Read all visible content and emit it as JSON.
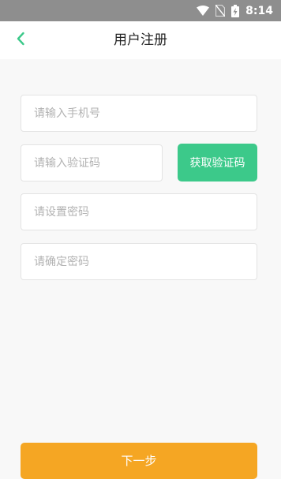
{
  "status_bar": {
    "time": "8:14",
    "icons": [
      "wifi-icon",
      "no-sim-icon",
      "battery-icon"
    ]
  },
  "header": {
    "back_icon": "chevron-left-icon",
    "title": "用户注册"
  },
  "form": {
    "phone_placeholder": "请输入手机号",
    "code_placeholder": "请输入验证码",
    "get_code_label": "获取验证码",
    "password_placeholder": "请设置密码",
    "confirm_placeholder": "请确定密码"
  },
  "footer": {
    "next_label": "下一步"
  },
  "colors": {
    "accent_green": "#3cc98a",
    "next_orange": "#f5a623",
    "status_bar": "#8e8e8e",
    "background": "#f8f8f8"
  }
}
